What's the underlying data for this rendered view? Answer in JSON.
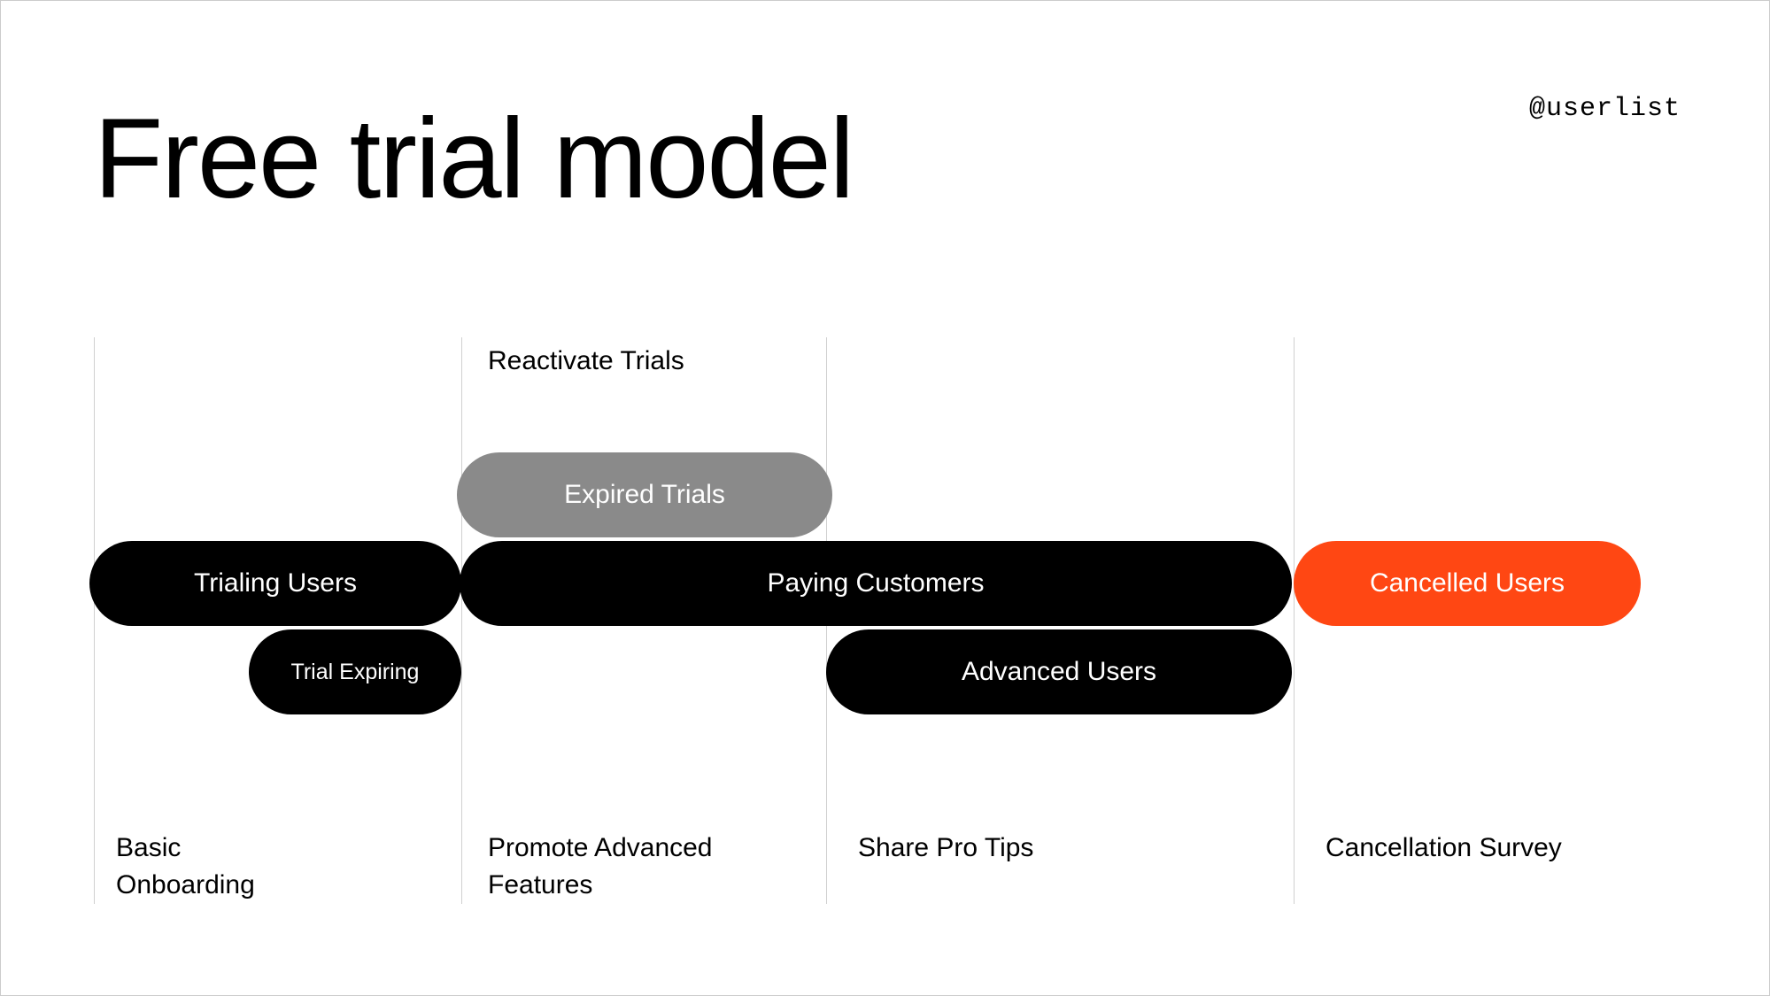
{
  "title": "Free trial model",
  "handle": "@userlist",
  "topLabels": {
    "reactivate": "Reactivate Trials"
  },
  "pills": {
    "expiredTrials": "Expired Trials",
    "trialingUsers": "Trialing Users",
    "payingCustomers": "Paying Customers",
    "cancelledUsers": "Cancelled Users",
    "trialExpiring": "Trial Expiring",
    "advancedUsers": "Advanced Users"
  },
  "bottomLabels": {
    "basicOnboarding": "Basic\nOnboarding",
    "promoteAdvanced": "Promote Advanced\nFeatures",
    "shareProTips": "Share Pro Tips",
    "cancellationSurvey": "Cancellation Survey"
  },
  "colors": {
    "black": "#000000",
    "gray": "#8a8a8a",
    "orange": "#ff4713"
  }
}
